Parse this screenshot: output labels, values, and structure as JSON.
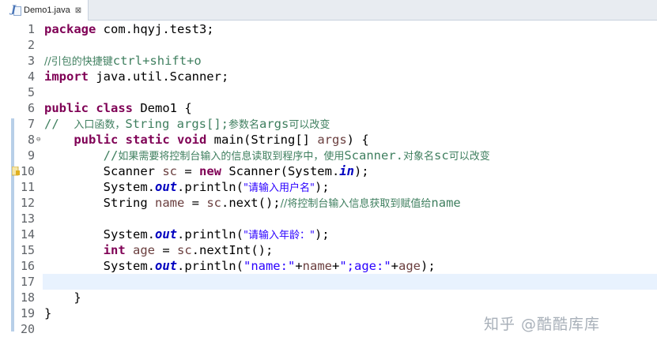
{
  "tab": {
    "filename": "Demo1.java",
    "close_glyph": "⊠"
  },
  "lines": [
    {
      "n": "1",
      "text": "package com.hqyj.test3;"
    },
    {
      "n": "2",
      "text": ""
    },
    {
      "n": "3",
      "text": "//引包的快捷键ctrl+shift+o"
    },
    {
      "n": "4",
      "text": "import java.util.Scanner;"
    },
    {
      "n": "5",
      "text": ""
    },
    {
      "n": "6",
      "text": "public class Demo1 {"
    },
    {
      "n": "7",
      "text": "//  入口函数，String args[];参数名args可以改变"
    },
    {
      "n": "8",
      "text": "    public static void main(String[] args) {"
    },
    {
      "n": "9",
      "text": "        //如果需要将控制台输入的信息读取到程序中，使用Scanner.对象名sc可以改变"
    },
    {
      "n": "10",
      "text": "        Scanner sc = new Scanner(System.in);"
    },
    {
      "n": "11",
      "text": "        System.out.println(\"请输入用户名\");"
    },
    {
      "n": "12",
      "text": "        String name = sc.next();//将控制台输入信息获取到赋值给name"
    },
    {
      "n": "13",
      "text": ""
    },
    {
      "n": "14",
      "text": "        System.out.println(\"请输入年龄：\");"
    },
    {
      "n": "15",
      "text": "        int age = sc.nextInt();"
    },
    {
      "n": "16",
      "text": "        System.out.println(\"name:\"+name+\";age:\"+age);"
    },
    {
      "n": "17",
      "text": ""
    },
    {
      "n": "18",
      "text": "    }"
    },
    {
      "n": "19",
      "text": "}"
    },
    {
      "n": "20",
      "text": ""
    }
  ],
  "parts": {
    "l1": [
      "package",
      " com.hqyj.test3;"
    ],
    "l3": [
      "//引包的快捷键",
      "ctrl+shift+o"
    ],
    "l4": [
      "import",
      " java.util.Scanner;"
    ],
    "l6": [
      "public",
      " ",
      "class",
      " Demo1 {"
    ],
    "l7": [
      "//  ",
      "入口函数，",
      "String args[];",
      "参数名",
      "args",
      "可以改变"
    ],
    "l8": [
      "    ",
      "public",
      " ",
      "static",
      " ",
      "void",
      " main(String[] ",
      "args",
      ") {"
    ],
    "l9": [
      "        //",
      "如果需要将控制台输入的信息读取到程序中，使用",
      "Scanner.",
      "对象名",
      "sc",
      "可以改变"
    ],
    "l10": [
      "        Scanner ",
      "sc",
      " = ",
      "new",
      " Scanner(System.",
      "in",
      ");"
    ],
    "l11": [
      "        System.",
      "out",
      ".println(",
      "\"请输入用户名\"",
      ");"
    ],
    "l12": [
      "        String ",
      "name",
      " = ",
      "sc",
      ".next();",
      "//将控制台输入信息获取到赋值给",
      "name"
    ],
    "l14": [
      "        System.",
      "out",
      ".println(",
      "\"请输入年龄：\"",
      ");"
    ],
    "l15": [
      "        ",
      "int",
      " ",
      "age",
      " = ",
      "sc",
      ".nextInt();"
    ],
    "l16": [
      "        System.",
      "out",
      ".println(",
      "\"name:\"",
      "+",
      "name",
      "+",
      "\";age:\"",
      "+",
      "age",
      ");"
    ],
    "l18": [
      "    }"
    ],
    "l19": [
      "}"
    ]
  },
  "watermark": "知乎 @酷酷库库",
  "colors": {
    "keyword": "#7f0055",
    "comment": "#3f7f5f",
    "string": "#2a00ff",
    "field": "#0000c0",
    "local": "#6a3e3e",
    "current_line": "#e8f2fe"
  }
}
